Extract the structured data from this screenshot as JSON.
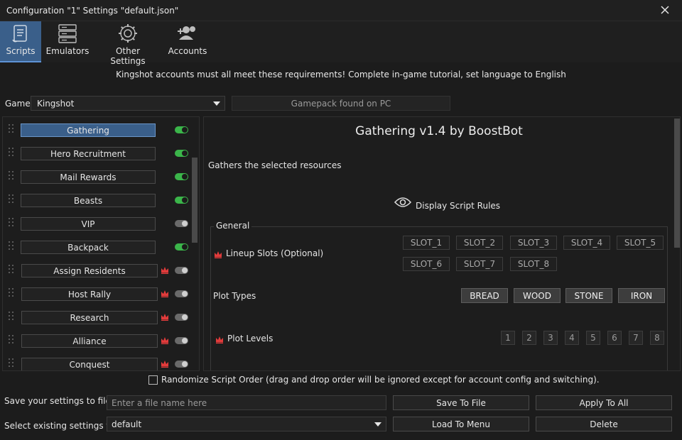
{
  "window": {
    "title": "Configuration \"1\" Settings \"default.json\""
  },
  "tabs": [
    {
      "label": "Scripts",
      "icon": "scroll-icon",
      "active": true
    },
    {
      "label": "Emulators",
      "icon": "server-icon",
      "active": false
    },
    {
      "label": "Other Settings",
      "icon": "gear-icon",
      "active": false
    },
    {
      "label": "Accounts",
      "icon": "user-plus-icon",
      "active": false
    }
  ],
  "banner": "Kingshot accounts must all meet these requirements! Complete in-game tutorial, set language to English",
  "game": {
    "label": "Game:",
    "value": "Kingshot",
    "gamepack_status": "Gamepack found on PC"
  },
  "scripts": [
    {
      "name": "Gathering",
      "enabled": true,
      "premium": false,
      "selected": true
    },
    {
      "name": "Hero Recruitment",
      "enabled": true,
      "premium": false,
      "selected": false
    },
    {
      "name": "Mail Rewards",
      "enabled": true,
      "premium": false,
      "selected": false
    },
    {
      "name": "Beasts",
      "enabled": true,
      "premium": false,
      "selected": false
    },
    {
      "name": "VIP",
      "enabled": false,
      "premium": false,
      "selected": false
    },
    {
      "name": "Backpack",
      "enabled": true,
      "premium": false,
      "selected": false
    },
    {
      "name": "Assign Residents",
      "enabled": false,
      "premium": true,
      "selected": false
    },
    {
      "name": "Host Rally",
      "enabled": false,
      "premium": true,
      "selected": false
    },
    {
      "name": "Research",
      "enabled": false,
      "premium": true,
      "selected": false
    },
    {
      "name": "Alliance",
      "enabled": false,
      "premium": true,
      "selected": false
    },
    {
      "name": "Conquest",
      "enabled": false,
      "premium": true,
      "selected": false
    }
  ],
  "detail": {
    "title": "Gathering v1.4 by BoostBot",
    "description": "Gathers the selected resources",
    "rules_label": "Display Script Rules",
    "group_label": "General",
    "lineup_label": "Lineup Slots (Optional)",
    "slots": [
      "SLOT_1",
      "SLOT_2",
      "SLOT_3",
      "SLOT_4",
      "SLOT_5",
      "SLOT_6",
      "SLOT_7",
      "SLOT_8"
    ],
    "plot_types_label": "Plot Types",
    "plot_types": [
      "BREAD",
      "WOOD",
      "STONE",
      "IRON"
    ],
    "plot_levels_label": "Plot Levels",
    "plot_levels": [
      "1",
      "2",
      "3",
      "4",
      "5",
      "6",
      "7",
      "8"
    ]
  },
  "randomize_label": "Randomize Script Order (drag and drop order will be ignored except for account config and switching).",
  "footer": {
    "save_label": "Save your settings to file",
    "file_placeholder": "Enter a file name here",
    "load_label": "Select existing settings file",
    "selected_file": "default",
    "save_button": "Save To File",
    "apply_button": "Apply To All",
    "load_button": "Load To Menu",
    "delete_button": "Delete"
  },
  "colors": {
    "accent": "#3a5f8a",
    "toggle_on": "#3bb54a",
    "crown": "#e23b3b"
  }
}
